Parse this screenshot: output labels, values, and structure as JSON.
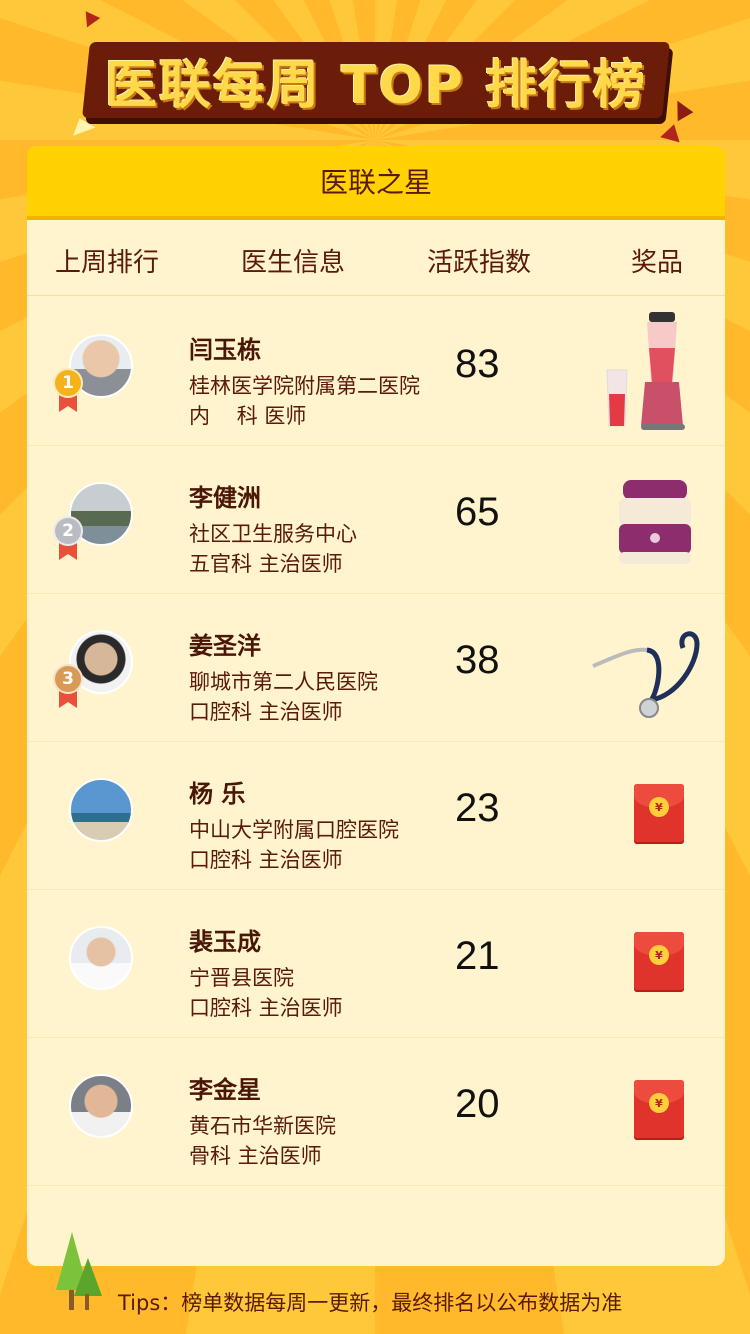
{
  "banner": {
    "title": "医联每周 TOP 排行榜"
  },
  "card": {
    "title": "医联之星"
  },
  "columns": {
    "rank": "上周排行",
    "doctor": "医生信息",
    "activity": "活跃指数",
    "prize": "奖品"
  },
  "colors": {
    "accent": "#ffd200",
    "text_dark": "#5a1a08",
    "red": "#e0332b",
    "gold_medal": "#f5b21b",
    "silver_medal": "#b9bcc1",
    "bronze_medal": "#d99a55"
  },
  "doctors": [
    {
      "rank": "1",
      "name": "闫玉栋",
      "hospital": "桂林医学院附属第二医院",
      "dept": "内    科 医师",
      "score": "83",
      "prize": "blender-icon"
    },
    {
      "rank": "2",
      "name": "李健洲",
      "hospital": "社区卫生服务中心",
      "dept": "五官科 主治医师",
      "score": "65",
      "prize": "lunchbox-icon"
    },
    {
      "rank": "3",
      "name": "姜圣洋",
      "hospital": "聊城市第二人民医院",
      "dept": "口腔科 主治医师",
      "score": "38",
      "prize": "stethoscope-icon"
    },
    {
      "rank": "",
      "name": "杨    乐",
      "hospital": "中山大学附属口腔医院",
      "dept": "口腔科 主治医师",
      "score": "23",
      "prize": "red-envelope-icon"
    },
    {
      "rank": "",
      "name": "裴玉成",
      "hospital": "宁晋县医院",
      "dept": "口腔科 主治医师",
      "score": "21",
      "prize": "red-envelope-icon"
    },
    {
      "rank": "",
      "name": "李金星",
      "hospital": "黄石市华新医院",
      "dept": "骨科 主治医师",
      "score": "20",
      "prize": "red-envelope-icon"
    }
  ],
  "redpack_symbol": "¥",
  "footer": {
    "tips": "Tips：榜单数据每周一更新，最终排名以公布数据为准"
  }
}
